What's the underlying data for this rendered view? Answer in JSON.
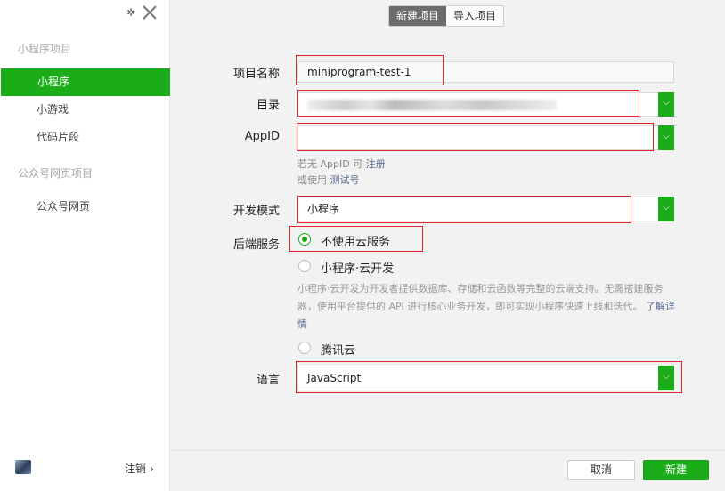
{
  "sidebar": {
    "section_miniprogram": "小程序项目",
    "items": [
      {
        "label": "小程序",
        "active": true
      },
      {
        "label": "小游戏",
        "active": false
      },
      {
        "label": "代码片段",
        "active": false
      }
    ],
    "section_official": "公众号网页项目",
    "official_item": "公众号网页",
    "logout_label": "注销 ›"
  },
  "tabs": [
    {
      "label": "新建项目",
      "active": true
    },
    {
      "label": "导入项目",
      "active": false
    }
  ],
  "form": {
    "name_label": "项目名称",
    "name_value": "miniprogram-test-1",
    "dir_label": "目录",
    "appid_label": "AppID",
    "appid_hint_prefix": "若无 AppID 可",
    "appid_hint_register": "注册",
    "appid_hint2_prefix": "或使用",
    "appid_hint2_test": "测试号",
    "mode_label": "开发模式",
    "mode_value": "小程序",
    "backend_label": "后端服务",
    "backend_options": [
      {
        "label": "不使用云服务",
        "checked": true
      },
      {
        "label": "小程序·云开发",
        "checked": false
      },
      {
        "label": "腾讯云",
        "checked": false
      }
    ],
    "cloud_desc": "小程序·云开发为开发者提供数据库、存储和云函数等完整的云端支持。无需搭建服务器，使用平台提供的 API 进行核心业务开发，即可实现小程序快速上线和迭代。",
    "cloud_desc_link": "了解详情",
    "lang_label": "语言",
    "lang_value": "JavaScript"
  },
  "footer": {
    "cancel_label": "取消",
    "create_label": "新建"
  },
  "colors": {
    "accent": "#1aad19",
    "highlight": "#e0262a"
  }
}
